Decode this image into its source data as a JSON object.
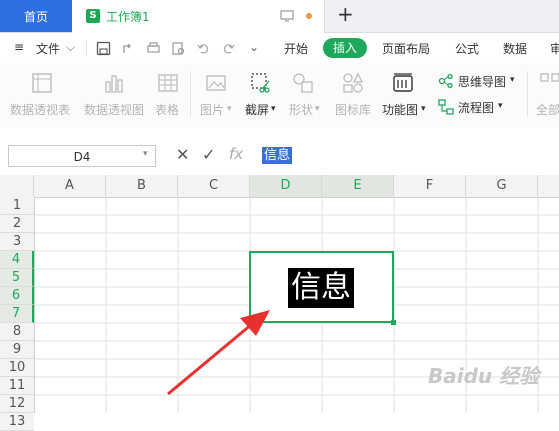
{
  "tabs": {
    "home": "首页",
    "document": "工作簿1",
    "doc_icon_letter": "S",
    "new_tab": "+"
  },
  "menu": {
    "file": "文件",
    "items": [
      "开始",
      "插入",
      "页面布局",
      "公式",
      "数据",
      "审"
    ]
  },
  "ribbon": {
    "items": [
      {
        "label": "数据透视表"
      },
      {
        "label": "数据透视图"
      },
      {
        "label": "表格"
      },
      {
        "label": "图片"
      },
      {
        "label": "截屏"
      },
      {
        "label": "形状"
      },
      {
        "label": "图标库"
      },
      {
        "label": "功能图"
      },
      {
        "label": "思维导图"
      },
      {
        "label": "流程图"
      },
      {
        "label": "全部"
      }
    ]
  },
  "formula_bar": {
    "cell_ref": "D4",
    "value": "信息"
  },
  "grid": {
    "columns": [
      "A",
      "B",
      "C",
      "D",
      "E",
      "F",
      "G"
    ],
    "rows": [
      "1",
      "2",
      "3",
      "4",
      "5",
      "6",
      "7",
      "8",
      "9",
      "10",
      "11",
      "12",
      "13"
    ],
    "cell_text": "信息"
  },
  "watermark": "Baidu 经验",
  "colors": {
    "accent": "#1fa85a",
    "home_tab": "#2f6fe4",
    "annotation_arrow": "#e8312f"
  }
}
